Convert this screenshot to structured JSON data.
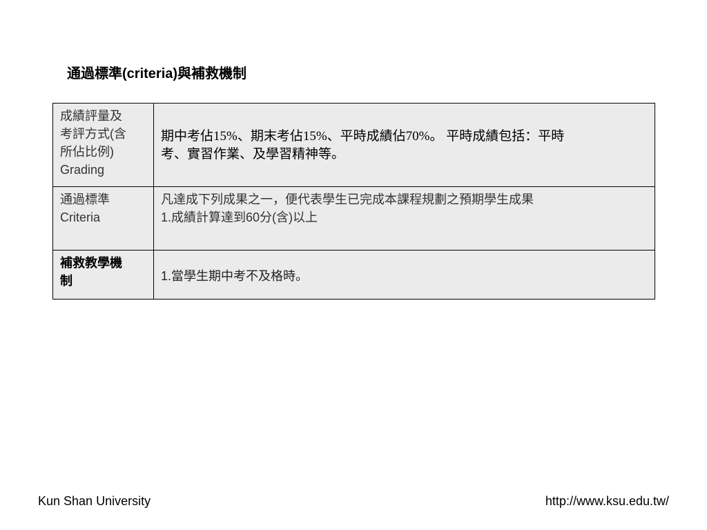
{
  "title": "通過標準(criteria)與補救機制",
  "table": {
    "rows": [
      {
        "label_lines": [
          "成績評量及",
          "考評方式(含",
          "所佔比例)",
          "Grading"
        ],
        "content_lines": [
          "期中考佔15%、期末考佔15%、平時成績佔70%。 平時成績包括：平時",
          "考、實習作業、及學習精神等。"
        ]
      },
      {
        "label_lines": [
          "通過標準",
          "Criteria"
        ],
        "content_lines": [
          "凡達成下列成果之一，便代表學生已完成本課程規劃之預期學生成果",
          "1.成績計算達到60分(含)以上"
        ]
      },
      {
        "label_lines": [
          "補救教學機",
          "制"
        ],
        "content_lines": [
          "1.當學生期中考不及格時。"
        ]
      }
    ]
  },
  "footer": {
    "left": "Kun Shan University",
    "right": "http://www.ksu.edu.tw/"
  }
}
